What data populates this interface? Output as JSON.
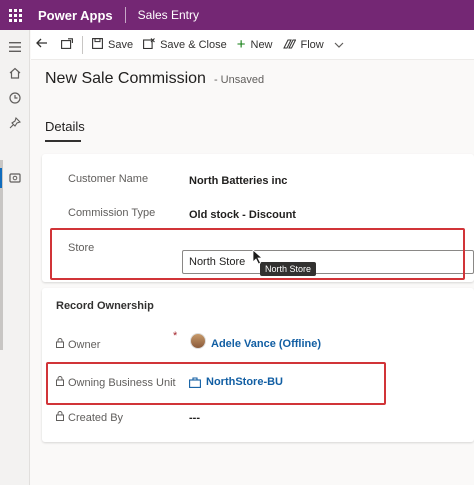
{
  "app": {
    "name": "Power Apps",
    "entity": "Sales Entry"
  },
  "toolbar": {
    "save_label": "Save",
    "save_close_label": "Save & Close",
    "new_label": "New",
    "flow_label": "Flow"
  },
  "form": {
    "title": "New Sale Commission",
    "status": "- Unsaved",
    "tab": "Details"
  },
  "fields": {
    "customer_name": {
      "label": "Customer Name",
      "value": "North Batteries inc"
    },
    "commission_type": {
      "label": "Commission Type",
      "value": "Old stock - Discount"
    },
    "store": {
      "label": "Store",
      "value": "North Store",
      "tooltip": "North Store"
    }
  },
  "ownership": {
    "section_title": "Record Ownership",
    "owner": {
      "label": "Owner",
      "required_marker": "*",
      "value": "Adele Vance (Offline)"
    },
    "owning_bu": {
      "label": "Owning Business Unit",
      "value": "NorthStore-BU"
    },
    "created_by": {
      "label": "Created By",
      "value": "---"
    }
  },
  "colors": {
    "brand": "#742774",
    "highlight": "#d13438",
    "link": "#115ea3"
  }
}
